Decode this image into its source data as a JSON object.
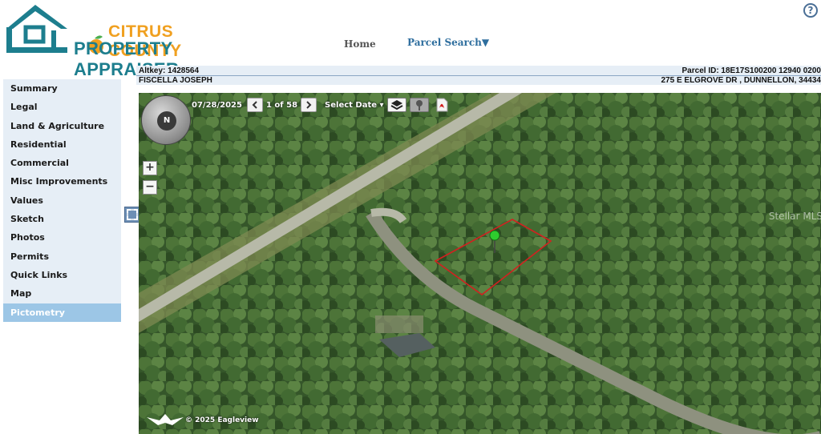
{
  "header": {
    "logo_line1": "CITRUS COUNTY",
    "logo_line2": "PROPERTY APPRAISER",
    "nav_home": "Home",
    "nav_parcel_search": "Parcel Search▼",
    "help": "?"
  },
  "info": {
    "altkey": "Altkey: 1428564",
    "parcel_id": "Parcel ID: 18E17S100200 12940 0200",
    "owner": "FISCELLA JOSEPH",
    "address": "275 E ELGROVE DR , DUNNELLON, 34434"
  },
  "sidebar": {
    "items": [
      {
        "label": "Summary"
      },
      {
        "label": "Legal"
      },
      {
        "label": "Land & Agriculture"
      },
      {
        "label": "Residential"
      },
      {
        "label": "Commercial"
      },
      {
        "label": "Misc Improvements"
      },
      {
        "label": "Values"
      },
      {
        "label": "Sketch"
      },
      {
        "label": "Photos"
      },
      {
        "label": "Permits"
      },
      {
        "label": "Quick Links"
      },
      {
        "label": "Map"
      },
      {
        "label": "Pictometry"
      }
    ],
    "active": "Pictometry"
  },
  "map": {
    "date": "07/28/2025",
    "image_count": "1 of 58",
    "select_date": "Select Date ▾",
    "compass_label": "N",
    "zoom_in": "+",
    "zoom_out": "−",
    "watermark": "Stellar MLS",
    "copyright": "© 2025 Eagleview",
    "parcel_outline_color": "#d42020",
    "marker_color": "#2ecc2e"
  },
  "colors": {
    "accent": "#1d7e8e",
    "logo_orange": "#f0a020",
    "sidebar_bg": "#e6eef6",
    "sidebar_active": "#9cc6e6"
  }
}
